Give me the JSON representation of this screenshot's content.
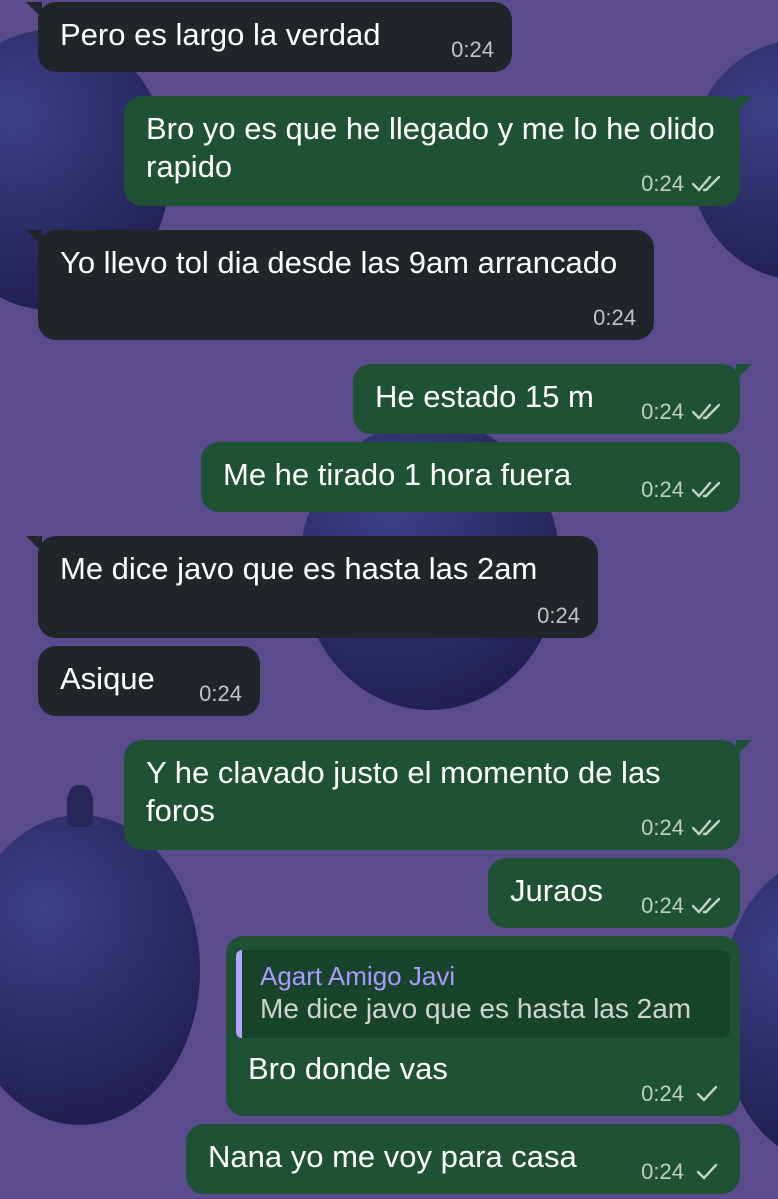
{
  "messages": [
    {
      "side": "in",
      "text": "Pero es largo la verdad",
      "time": "0:24"
    },
    {
      "side": "out",
      "text": "Bro yo es que he llegado y me lo he olido rapido",
      "time": "0:24",
      "status": "read"
    },
    {
      "side": "in",
      "text": "Yo llevo tol dia desde las 9am arrancado",
      "time": "0:24"
    },
    {
      "side": "out",
      "text": "He estado 15 m",
      "time": "0:24",
      "status": "read"
    },
    {
      "side": "out",
      "text": "Me he tirado 1 hora fuera",
      "time": "0:24",
      "status": "read"
    },
    {
      "side": "in",
      "text": "Me dice javo que es hasta las 2am",
      "time": "0:24"
    },
    {
      "side": "in",
      "text": "Asique",
      "time": "0:24"
    },
    {
      "side": "out",
      "text": "Y he clavado justo el momento de las foros",
      "time": "0:24",
      "status": "read"
    },
    {
      "side": "out",
      "text": "Juraos",
      "time": "0:24",
      "status": "read"
    },
    {
      "side": "out",
      "reply_to": {
        "author": "Agart Amigo Javi",
        "text": "Me dice javo que es hasta las 2am"
      },
      "text": "Bro donde vas",
      "time": "0:24",
      "status": "sent"
    },
    {
      "side": "out",
      "text": "Nana yo me voy para casa",
      "time": "0:24",
      "status": "sent"
    }
  ],
  "colors": {
    "wallpaper": "#5a4b8c",
    "incoming_bubble": "#1f2528",
    "outgoing_bubble": "#1f5133",
    "quote_accent": "#b6a4ff"
  }
}
